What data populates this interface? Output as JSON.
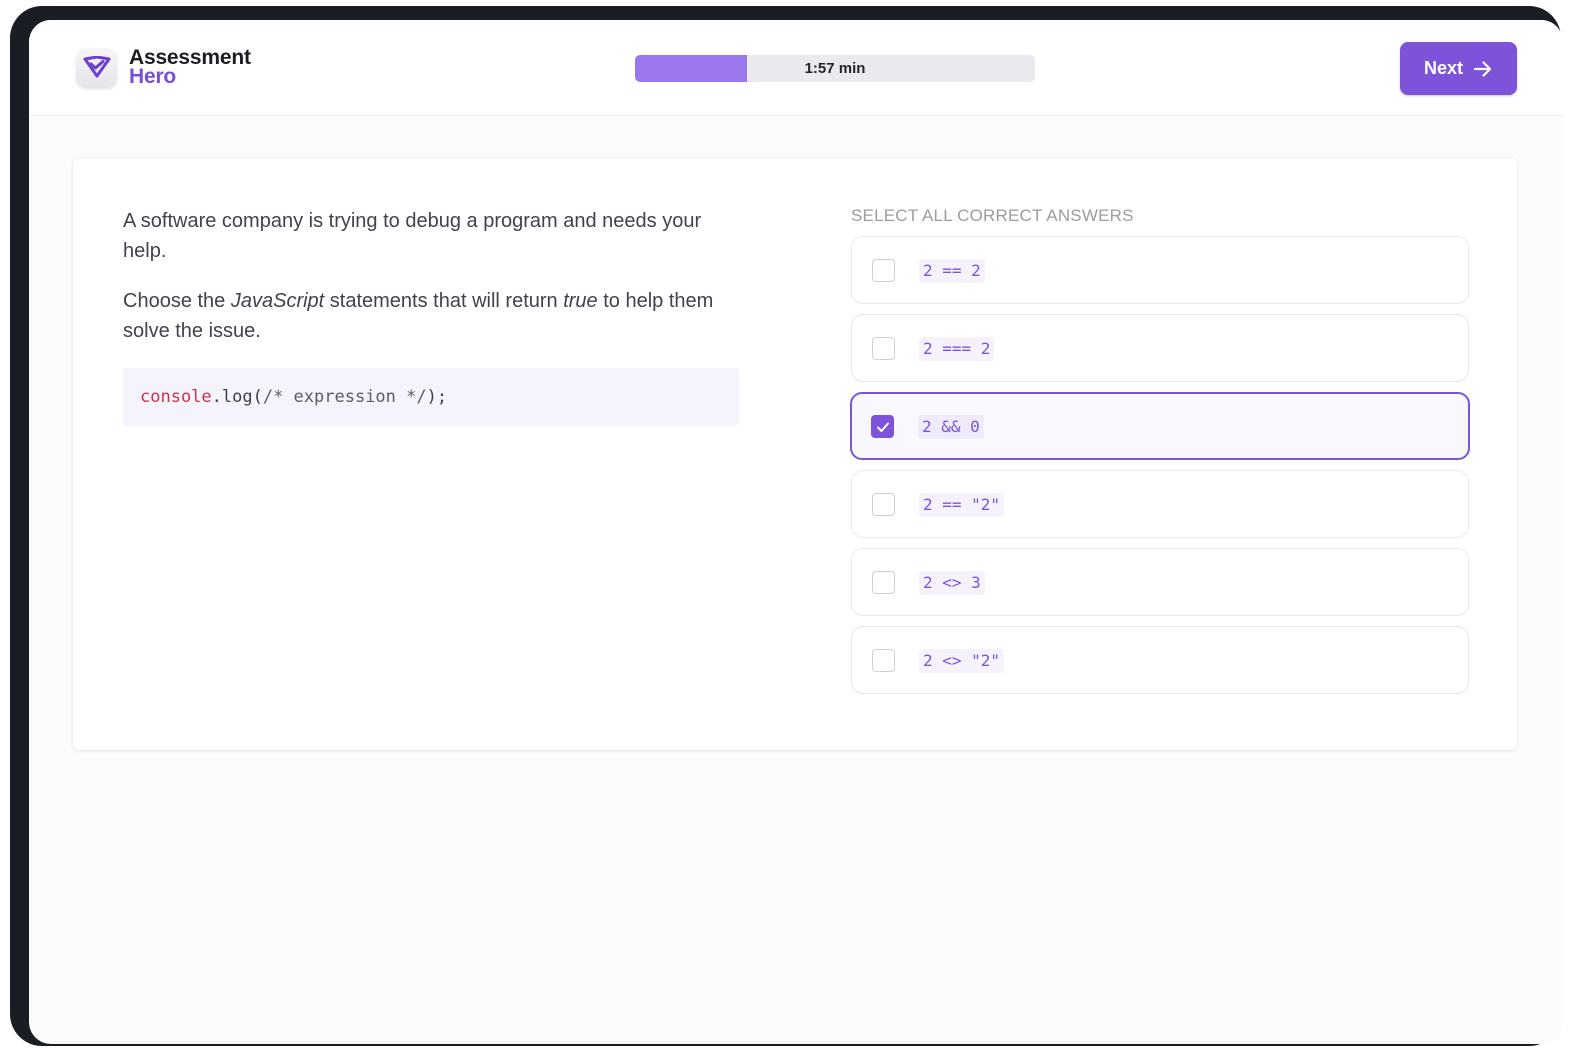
{
  "app": {
    "brand_line1": "Assessment",
    "brand_line2": "Hero",
    "logo_icon": "shield-check-icon"
  },
  "header": {
    "timer_label": "1:57 min",
    "timer_progress": 0.28,
    "next_label": "Next",
    "next_icon": "arrow-right-icon"
  },
  "colors": {
    "accent": "#7c53d9",
    "timer_fill": "#9b77ee",
    "code_keyword": "#c8324a"
  },
  "question": {
    "paragraph1": "A software company is trying to debug a program and needs your help.",
    "paragraph2_before": "Choose the ",
    "paragraph2_em1": "JavaScript",
    "paragraph2_mid": " statements that will return ",
    "paragraph2_em2": "true",
    "paragraph2_after": " to help them solve the issue.",
    "code": {
      "object": "console",
      "method": ".log(",
      "comment": "/* expression */",
      "end": ");"
    }
  },
  "answers": {
    "title": "SELECT ALL CORRECT ANSWERS",
    "options": [
      {
        "code": "2 == 2",
        "checked": false
      },
      {
        "code": "2 === 2",
        "checked": false
      },
      {
        "code": "2 && 0",
        "checked": true
      },
      {
        "code": "2 == \"2\"",
        "checked": false
      },
      {
        "code": "2 <> 3",
        "checked": false
      },
      {
        "code": "2 <> \"2\"",
        "checked": false
      }
    ]
  }
}
